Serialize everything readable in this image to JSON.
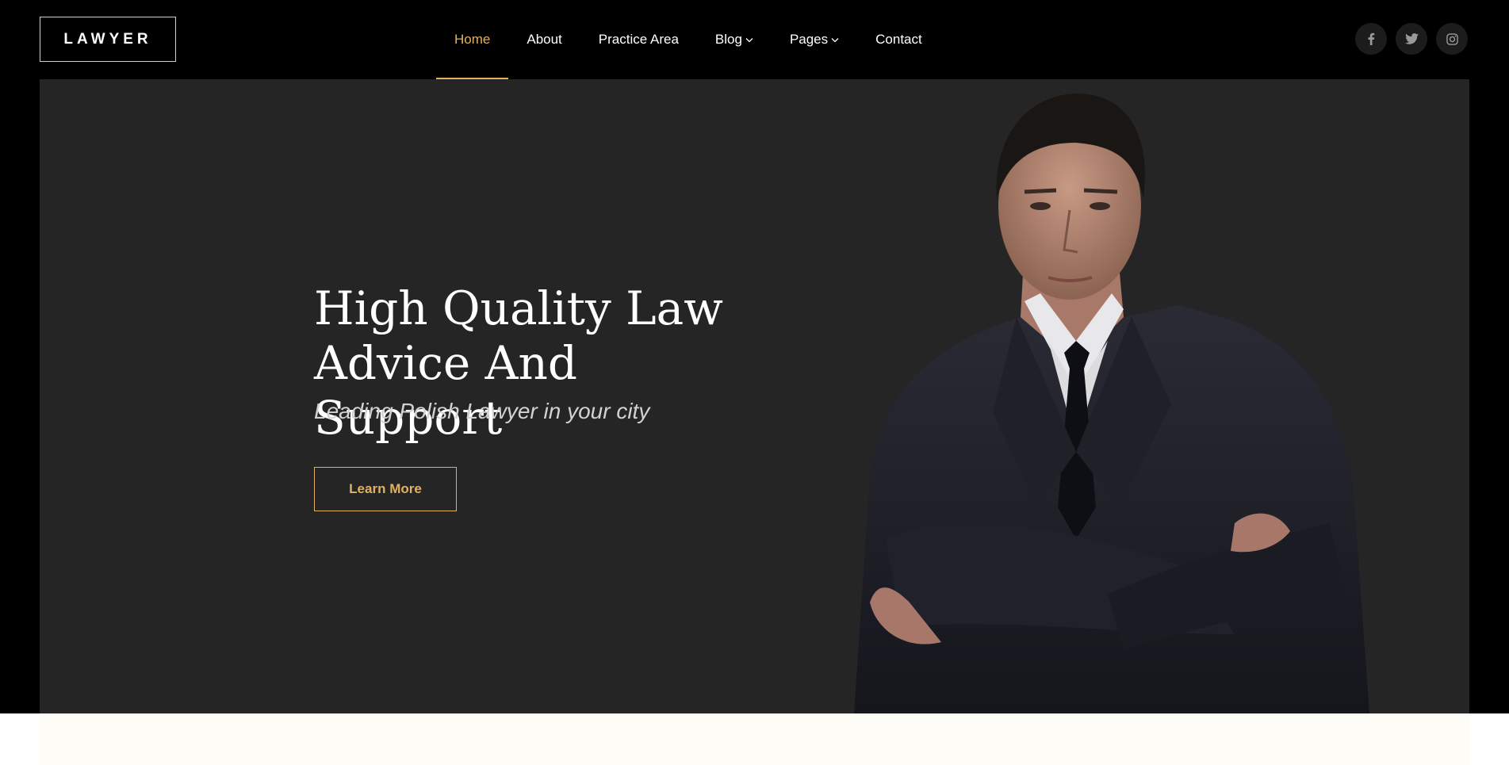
{
  "brand": {
    "logo_text": "LAWYER"
  },
  "nav": {
    "items": [
      {
        "label": "Home",
        "active": true
      },
      {
        "label": "About"
      },
      {
        "label": "Practice Area"
      },
      {
        "label": "Blog",
        "dropdown": true
      },
      {
        "label": "Pages",
        "dropdown": true
      },
      {
        "label": "Contact"
      }
    ]
  },
  "social": [
    "facebook-icon",
    "twitter-icon",
    "instagram-icon"
  ],
  "hero": {
    "title_line1": "High Quality Law",
    "title_line2": "Advice And Support",
    "subtitle": "Leading Polish Lawyer in your city",
    "cta_label": "Learn More"
  },
  "colors": {
    "accent": "#e2b15f",
    "hero_bg": "#252526",
    "page_bg": "#000000"
  }
}
